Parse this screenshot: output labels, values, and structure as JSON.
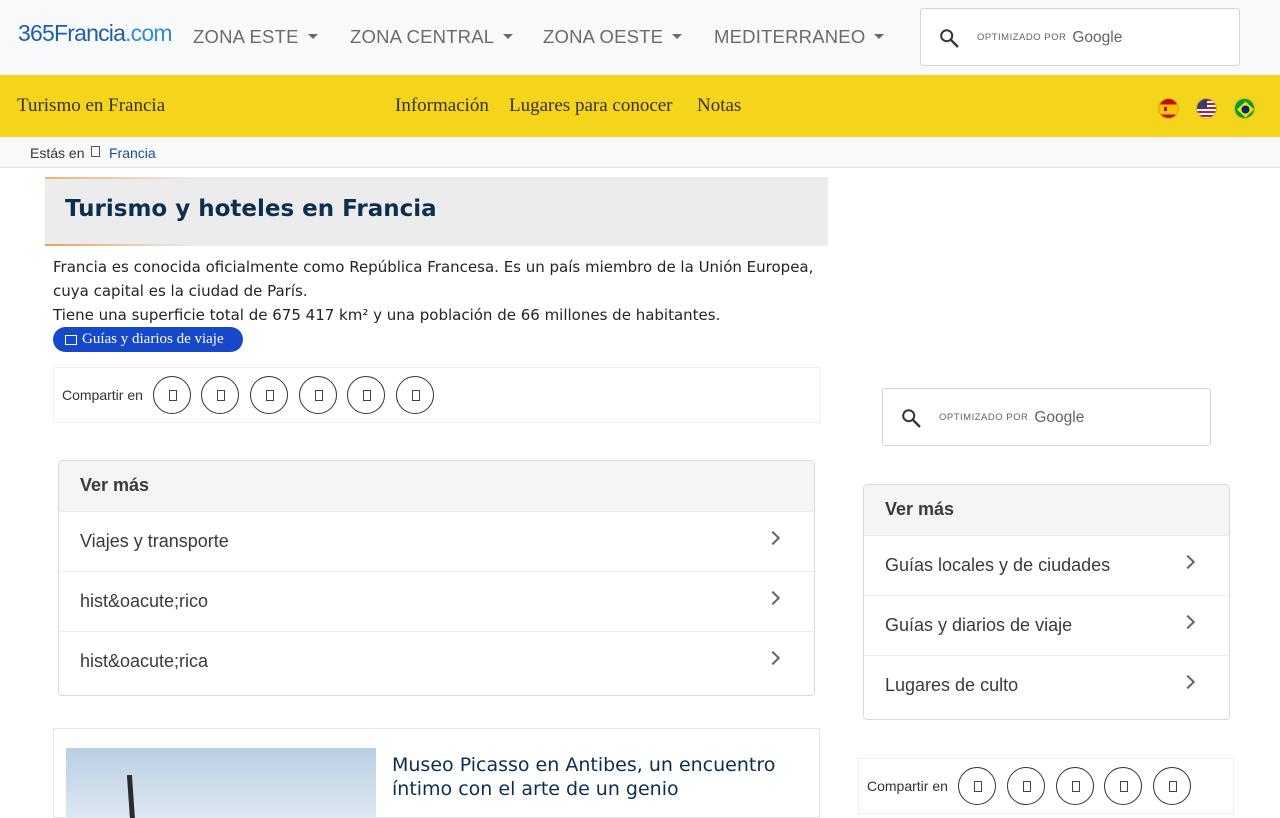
{
  "header": {
    "logo_main": "365Francia",
    "logo_tld": ".com",
    "nav": [
      {
        "label": "ZONA ESTE"
      },
      {
        "label": "ZONA CENTRAL"
      },
      {
        "label": "ZONA OESTE"
      },
      {
        "label": "MEDITERRANEO"
      }
    ],
    "search": {
      "powered_by": "OPTIMIZADO POR",
      "brand": "Google"
    }
  },
  "subheader": {
    "title": "Turismo en Francia",
    "links": [
      {
        "label": "Información"
      },
      {
        "label": "Lugares para conocer"
      },
      {
        "label": "Notas"
      }
    ],
    "flags": [
      {
        "name": "spain",
        "colors": [
          "#c60b1e",
          "#ffc400",
          "#c60b1e"
        ]
      },
      {
        "name": "usa",
        "colors": [
          "#b22234",
          "#ffffff",
          "#3c3b6e"
        ]
      },
      {
        "name": "brazil",
        "colors": [
          "#009b3a",
          "#fedf00",
          "#002776"
        ]
      }
    ]
  },
  "breadcrumb": {
    "label": "Estás en",
    "home_icon": "home-icon",
    "current": "Francia"
  },
  "article": {
    "title": "Turismo y hoteles en Francia",
    "paragraph1": "Francia es conocida oficialmente como República Francesa. Es un país miembro de la Unión Europea, cuya capital es la ciudad de París.",
    "paragraph2": "Tiene una superficie total de 675 417 km² y una población de 66 millones de habitantes.",
    "tag_label": "Guías y diarios de viaje",
    "share_label": "Compartir en",
    "share_buttons": [
      "facebook-icon",
      "twitter-icon",
      "pinterest-icon",
      "whatsapp-icon",
      "telegram-icon",
      "email-icon"
    ]
  },
  "more_main": {
    "title": "Ver más",
    "items": [
      {
        "label": "Viajes y transporte"
      },
      {
        "label": "hist&oacute;rico"
      },
      {
        "label": "hist&oacute;rica"
      }
    ]
  },
  "sidebar": {
    "search": {
      "powered_by": "OPTIMIZADO POR",
      "brand": "Google"
    },
    "more": {
      "title": "Ver más",
      "items": [
        {
          "label": "Guías locales y de ciudades"
        },
        {
          "label": "Guías y diarios de viaje"
        },
        {
          "label": "Lugares de culto"
        }
      ]
    },
    "share_label": "Compartir en",
    "share_buttons": [
      "facebook-icon",
      "twitter-icon",
      "pinterest-icon",
      "whatsapp-icon",
      "telegram-icon"
    ]
  },
  "teaser": {
    "title": "Museo Picasso en Antibes, un encuentro íntimo con el arte de un genio",
    "image": "museum-photo"
  },
  "colors": {
    "accent_yellow": "#f5d41c",
    "pill_blue": "#1549c9",
    "heading_navy": "#0c2f4f"
  }
}
